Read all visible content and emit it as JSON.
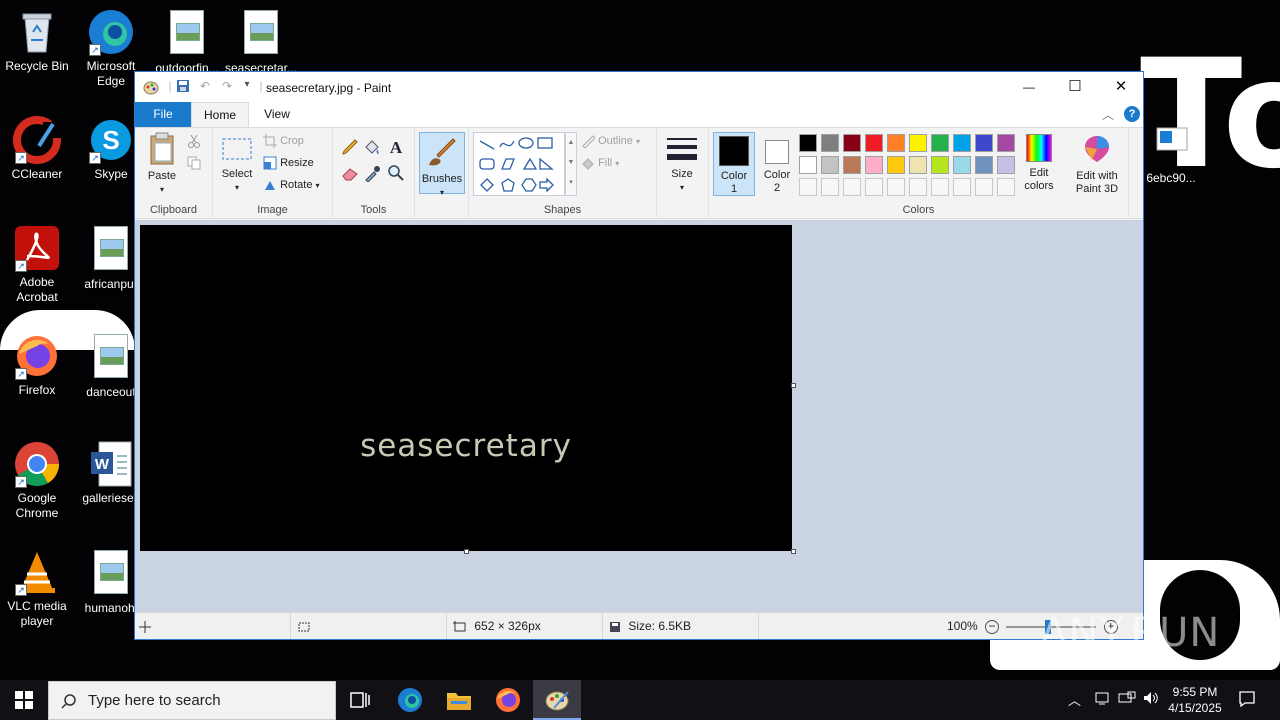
{
  "desktop": {
    "icons": [
      {
        "label": "Recycle Bin",
        "icon": "recycle-bin-icon"
      },
      {
        "label": "Microsoft Edge",
        "icon": "edge-icon"
      },
      {
        "label": "outdoorfin...",
        "icon": "image-file-icon"
      },
      {
        "label": "seasecretar...",
        "icon": "image-file-icon"
      },
      {
        "label": "CCleaner",
        "icon": "ccleaner-icon"
      },
      {
        "label": "Skype",
        "icon": "skype-icon"
      },
      {
        "label": "Adobe Acrobat",
        "icon": "acrobat-icon"
      },
      {
        "label": "africanpur",
        "icon": "image-file-icon"
      },
      {
        "label": "Firefox",
        "icon": "firefox-icon"
      },
      {
        "label": "danceout",
        "icon": "image-file-icon"
      },
      {
        "label": "Google Chrome",
        "icon": "chrome-icon"
      },
      {
        "label": "galleriesey",
        "icon": "word-doc-icon"
      },
      {
        "label": "VLC media player",
        "icon": "vlc-icon"
      },
      {
        "label": "humanohi",
        "icon": "image-file-icon"
      },
      {
        "label": "6ebc90...",
        "icon": "file-icon"
      }
    ]
  },
  "window": {
    "title": "seasecretary.jpg - Paint",
    "controls": {
      "minimize": "—",
      "maximize": "☐",
      "close": "✕"
    }
  },
  "tabs": {
    "file": "File",
    "home": "Home",
    "view": "View"
  },
  "ribbon": {
    "clipboard": {
      "paste": "Paste",
      "group": "Clipboard"
    },
    "image": {
      "select": "Select",
      "crop": "Crop",
      "resize": "Resize",
      "rotate": "Rotate",
      "group": "Image"
    },
    "tools": {
      "group": "Tools"
    },
    "brushes": "Brushes",
    "shapes": {
      "outline": "Outline",
      "fill": "Fill",
      "group": "Shapes"
    },
    "size": "Size",
    "color1": "Color 1",
    "color2": "Color 2",
    "colors_group": "Colors",
    "edit_colors": "Edit colors",
    "edit_paint3d": "Edit with Paint 3D",
    "palette_row1": [
      "#000000",
      "#7f7f7f",
      "#880015",
      "#ed1c24",
      "#ff7f27",
      "#fff200",
      "#22b14c",
      "#00a2e8",
      "#3f48cc",
      "#a349a4"
    ],
    "palette_row2": [
      "#ffffff",
      "#c3c3c3",
      "#b97a57",
      "#ffaec9",
      "#ffc90e",
      "#efe4b0",
      "#b5e61d",
      "#99d9ea",
      "#7092be",
      "#c8bfe7"
    ],
    "palette_row3": [
      "#f7f7f7",
      "#f7f7f7",
      "#f7f7f7",
      "#f7f7f7",
      "#f7f7f7",
      "#f7f7f7",
      "#f7f7f7",
      "#f7f7f7",
      "#f7f7f7",
      "#f7f7f7"
    ]
  },
  "canvas": {
    "text": "seasecretary"
  },
  "status": {
    "dimensions": "652 × 326px",
    "size": "Size: 6.5KB",
    "zoom": "100%"
  },
  "taskbar": {
    "search_placeholder": "Type here to search",
    "time": "9:55 PM",
    "date": "4/15/2025"
  },
  "watermark": "ANY.RUN"
}
